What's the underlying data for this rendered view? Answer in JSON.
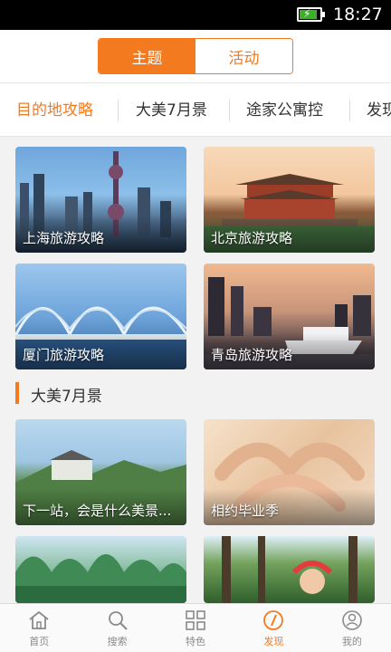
{
  "status_bar": {
    "time": "18:27",
    "icons": [
      "battery-charging-icon"
    ],
    "battery_level": 0.8
  },
  "header": {
    "segments": [
      {
        "label": "主题",
        "active": true
      },
      {
        "label": "活动",
        "active": false
      }
    ]
  },
  "categories": [
    {
      "label": "目的地攻略",
      "active": true
    },
    {
      "label": "大美7月景",
      "active": false
    },
    {
      "label": "途家公寓控",
      "active": false
    },
    {
      "label": "发现",
      "active": false
    }
  ],
  "destination_cards": [
    {
      "caption": "上海旅游攻略"
    },
    {
      "caption": "北京旅游攻略"
    },
    {
      "caption": "厦门旅游攻略"
    },
    {
      "caption": "青岛旅游攻略"
    }
  ],
  "section": {
    "title": "大美7月景"
  },
  "theme_cards": [
    {
      "caption": "下一站，会是什么美景..."
    },
    {
      "caption": "相约毕业季"
    },
    {
      "caption": ""
    },
    {
      "caption": ""
    }
  ],
  "tabbar": {
    "items": [
      {
        "label": "首页",
        "icon": "home-icon",
        "active": false
      },
      {
        "label": "搜索",
        "icon": "search-icon",
        "active": false
      },
      {
        "label": "特色",
        "icon": "grid-icon",
        "active": false
      },
      {
        "label": "发现",
        "icon": "compass-icon",
        "active": true
      },
      {
        "label": "我的",
        "icon": "user-icon",
        "active": false
      }
    ]
  },
  "colors": {
    "accent": "#f47a20",
    "tab_inactive": "#8a8a8a"
  }
}
